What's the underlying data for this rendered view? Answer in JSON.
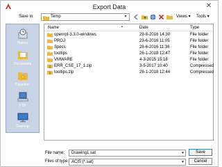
{
  "window": {
    "title": "Export Data",
    "close_glyph": "✕"
  },
  "toolbar": {
    "save_in_label": "Save in:",
    "save_in_value": "Temp",
    "views_label": "Views",
    "tools_label": "Tools"
  },
  "places": [
    {
      "label": "History",
      "icon": "history-icon"
    },
    {
      "label": "Documents",
      "icon": "documents-icon"
    },
    {
      "label": "Favorites",
      "icon": "favorites-icon"
    },
    {
      "label": "FTP",
      "icon": "ftp-icon"
    },
    {
      "label": "Desktop",
      "icon": "desktop-icon"
    }
  ],
  "filelist": {
    "headers": {
      "name": "Name",
      "date": "Date",
      "type": "Type"
    },
    "rows": [
      {
        "name": "openrpt-3.3.0-windows",
        "date": "29-8-2016 14:30",
        "type": "File folder",
        "icon": "folder-icon"
      },
      {
        "name": "PROJ",
        "date": "23-6-2016 11:05",
        "type": "File folder",
        "icon": "folder-icon"
      },
      {
        "name": "Specs",
        "date": "28-6-2016 11:36",
        "type": "File folder",
        "icon": "folder-icon"
      },
      {
        "name": "tooltips",
        "date": "26-1-2018 12:47",
        "type": "File folder",
        "icon": "folder-icon"
      },
      {
        "name": "VMWARE",
        "date": "4-3-2015 15:16",
        "type": "File folder",
        "icon": "folder-icon"
      },
      {
        "name": "ERR_CSE_17_1.zip",
        "date": "3-5-2017 10:40",
        "type": "Compressed",
        "icon": "zip-folder-icon"
      },
      {
        "name": "tooltips.zip",
        "date": "26-1-2018 12:44",
        "type": "Compressed",
        "icon": "zip-folder-icon"
      }
    ]
  },
  "footer": {
    "file_name_label": "File name:",
    "file_name_value": "Drawing1.sat",
    "file_type_label": "Files of type:",
    "file_type_value": "ACIS (*.sat)",
    "save_label": "Save",
    "cancel_label": "Cancel"
  },
  "colors": {
    "places_bg": "#c9d3e6",
    "folder": "#e8b84a",
    "accent_border": "#3c7fb1"
  }
}
